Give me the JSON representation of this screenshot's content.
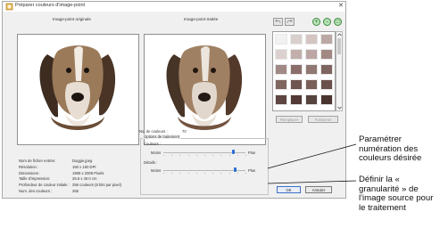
{
  "dialog": {
    "title": "Préparer couleurs d'image-point",
    "close_glyph": "✕"
  },
  "panels": {
    "original_title": "Image-point originale",
    "processed_title": "Image-point traitée"
  },
  "toolbar": {
    "zoom_in": "+",
    "zoom_out": "−",
    "zoom_fit": "□"
  },
  "palette": {
    "colors": [
      "#f3f1f1",
      "#d9cfcd",
      "#d4c5c3",
      "#bba8a5",
      "#dcd1cf",
      "#c2aeaa",
      "#bca6a3",
      "#a38984",
      "#a08985",
      "#8b6d69",
      "#917873",
      "#7e6560",
      "#806560",
      "#6f544f",
      "#7a5e58",
      "#6a4f4a",
      "#5e4642",
      "#523a36",
      "#564340",
      "#4a3430"
    ]
  },
  "palette_buttons": {
    "replace": "Remplacer",
    "merge": "Fusionner"
  },
  "info": {
    "labels": [
      "Nom de fichier entrée:",
      "Résolution :",
      "Dimensions :",
      "Taille d'impression:",
      "Profondeur de couleur initiale :",
      "Num. des couleurs :"
    ],
    "values": [
      "Doggie.jpeg",
      "150 x 150 DPI",
      "1909 x 2009 Pixels",
      "25.6 x 40.0 cm",
      "256 couleurs (8 bits par pixel)",
      "255"
    ]
  },
  "processing": {
    "num_colors_label": "No. de couleurs :",
    "num_colors_value": "70",
    "group_title": "Options de traitement",
    "colors_label": "Couleurs :",
    "colors_min": "Moins",
    "colors_max": "Plus",
    "colors_level": 0.85,
    "detail_label": "Détails :",
    "detail_min": "Moins",
    "detail_max": "Plus",
    "detail_level": 0.88
  },
  "buttons": {
    "ok": "OK",
    "cancel": "Annuler"
  },
  "annotations": {
    "top": "Paramétrer numération des couleurs désirée",
    "bottom": "Définir la « granularité » de l'image source pour le traitement"
  }
}
